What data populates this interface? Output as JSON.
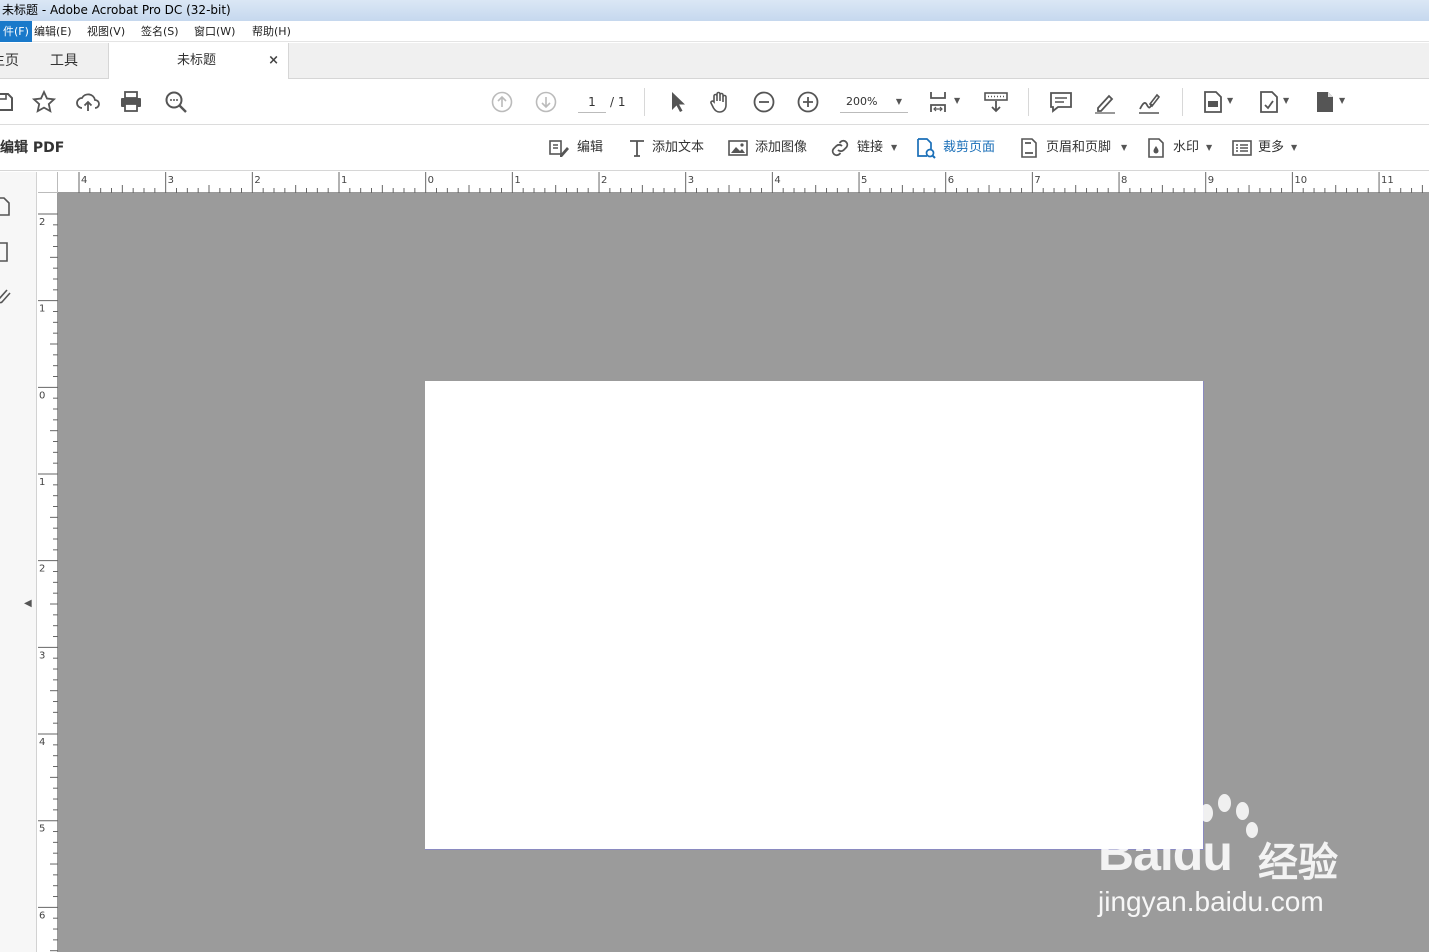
{
  "window": {
    "title": "未标题 - Adobe Acrobat Pro DC (32-bit)"
  },
  "menu": [
    {
      "label": "件(F)",
      "active": true
    },
    {
      "label": "编辑(E)"
    },
    {
      "label": "视图(V)"
    },
    {
      "label": "签名(S)"
    },
    {
      "label": "窗口(W)"
    },
    {
      "label": "帮助(H)"
    }
  ],
  "tabs": {
    "home": "主页",
    "tools": "工具",
    "document": "未标题",
    "close": "×"
  },
  "toolbar": {
    "page_current": "1",
    "page_total": "/ 1",
    "zoom": "200%",
    "icons": [
      "save-icon",
      "bookmark-star-icon",
      "upload-cloud-icon",
      "print-icon",
      "find-icon",
      "page-up-icon",
      "page-down-icon",
      "select-arrow-icon",
      "hand-icon",
      "zoom-out-icon",
      "zoom-in-icon",
      "fit-page-icon",
      "keyboard-scroll-icon",
      "comment-icon",
      "highlight-icon",
      "sign-icon",
      "tool-a-icon",
      "tool-b-icon",
      "tool-c-icon"
    ]
  },
  "edit_pdf": {
    "title": "编辑 PDF",
    "tools": {
      "edit": "编辑",
      "add_text": "添加文本",
      "add_image": "添加图像",
      "link": "链接",
      "crop": "裁剪页面",
      "header_footer": "页眉和页脚",
      "watermark": "水印",
      "more": "更多"
    }
  },
  "ruler": {
    "horizontal_labels": [
      "4",
      "3",
      "2",
      "1",
      "0",
      "1",
      "2",
      "3",
      "4",
      "5",
      "6",
      "7",
      "8",
      "9",
      "10",
      "11"
    ],
    "vertical_labels": [
      "2",
      "1",
      "0",
      "1",
      "2",
      "3",
      "4",
      "5",
      "6"
    ]
  },
  "watermark": {
    "logo": "Baidu",
    "cn": "经验",
    "url": "jingyan.baidu.com"
  },
  "colors": {
    "accent": "#1a6fb8",
    "canvas": "#9b9b9b",
    "menu_active": "#1979ca"
  }
}
